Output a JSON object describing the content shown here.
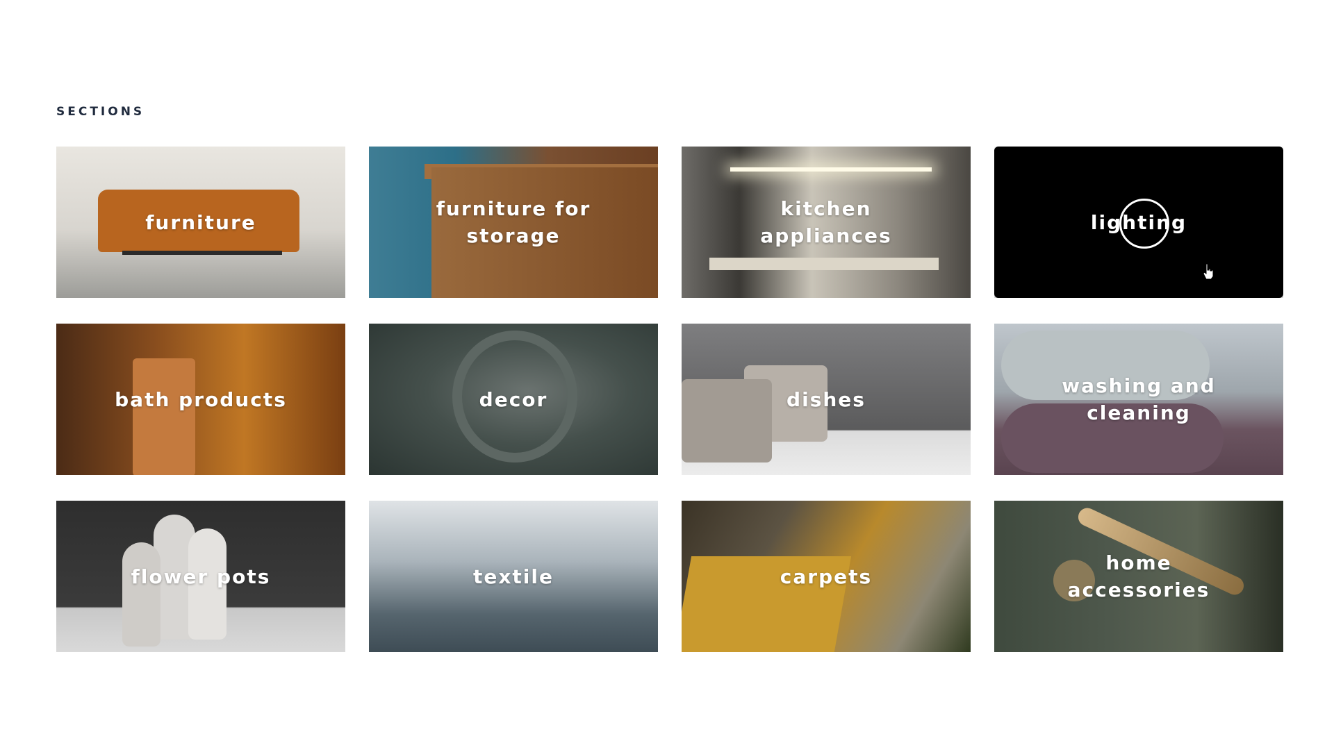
{
  "page": {
    "heading": "SECTIONS"
  },
  "tiles": [
    {
      "label": "furniture"
    },
    {
      "label": "furniture for storage"
    },
    {
      "label": "kitchen appliances"
    },
    {
      "label": "lighting"
    },
    {
      "label": "bath products"
    },
    {
      "label": "decor"
    },
    {
      "label": "dishes"
    },
    {
      "label": "washing and cleaning"
    },
    {
      "label": "flower pots"
    },
    {
      "label": "textile"
    },
    {
      "label": "carpets"
    },
    {
      "label": "home accessories"
    }
  ],
  "colors": {
    "heading": "#1f2a3d",
    "label": "#ffffff",
    "hovered_tile": "#000000"
  },
  "icons": {
    "cursor": "hand-pointer-icon",
    "focus": "focus-ring"
  }
}
